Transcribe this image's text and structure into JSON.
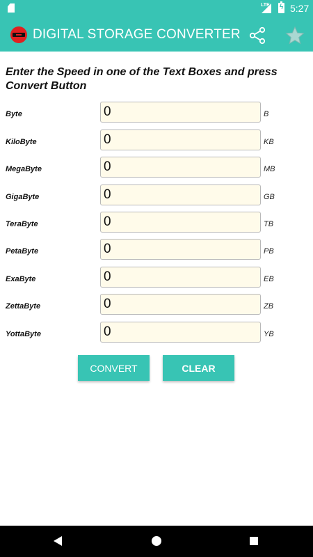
{
  "status_bar": {
    "network": "LTE",
    "time": "5:27",
    "icons": [
      "sd-card-icon",
      "signal-icon",
      "battery-charging-icon"
    ]
  },
  "app_bar": {
    "title": "DIGITAL STORAGE CONVERTER",
    "icons": [
      "app-logo-icon",
      "share-icon",
      "star-icon"
    ],
    "accent_color": "#38c4b4"
  },
  "instruction": "Enter the Speed in one of the Text Boxes and press Convert Button",
  "rows": [
    {
      "label": "Byte",
      "value": "0",
      "unit": "B"
    },
    {
      "label": "KiloByte",
      "value": "0",
      "unit": "KB"
    },
    {
      "label": "MegaByte",
      "value": "0",
      "unit": "MB"
    },
    {
      "label": "GigaByte",
      "value": "0",
      "unit": "GB"
    },
    {
      "label": "TeraByte",
      "value": "0",
      "unit": "TB"
    },
    {
      "label": "PetaByte",
      "value": "0",
      "unit": "PB"
    },
    {
      "label": "ExaByte",
      "value": "0",
      "unit": "EB"
    },
    {
      "label": "ZettaByte",
      "value": "0",
      "unit": "ZB"
    },
    {
      "label": "YottaByte",
      "value": "0",
      "unit": "YB"
    }
  ],
  "buttons": {
    "convert": "CONVERT",
    "clear": "CLEAR"
  },
  "nav_bar": {
    "icons": [
      "back-icon",
      "home-icon",
      "recents-icon"
    ]
  },
  "colors": {
    "primary": "#38c4b4",
    "input_background": "#fffbea"
  }
}
